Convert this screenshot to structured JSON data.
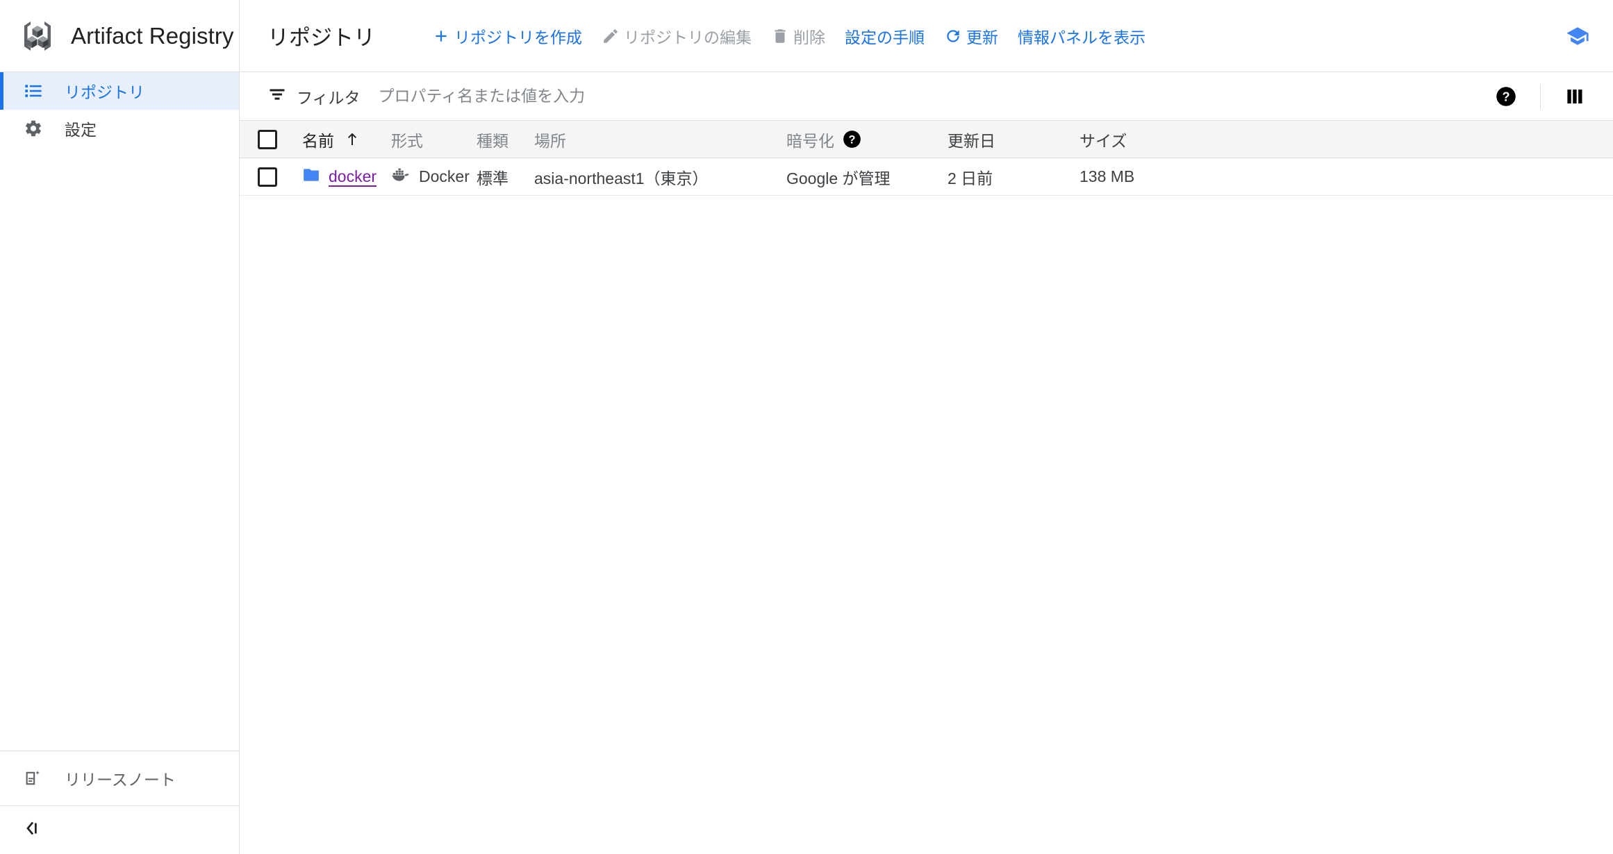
{
  "brand": {
    "title": "Artifact Registry",
    "logo_icon": "artifact-registry-cubes-logo"
  },
  "toolbar": {
    "page_title": "リポジトリ",
    "actions": [
      {
        "label": "リポジトリを作成",
        "icon": "plus-icon",
        "state": "enabled"
      },
      {
        "label": "リポジトリの編集",
        "icon": "pencil-icon",
        "state": "disabled"
      },
      {
        "label": "削除",
        "icon": "trash-icon",
        "state": "disabled"
      },
      {
        "label": "設定の手順",
        "icon": "none",
        "state": "enabled"
      },
      {
        "label": "更新",
        "icon": "refresh-icon",
        "state": "enabled"
      },
      {
        "label": "情報パネルを表示",
        "icon": "none",
        "state": "enabled"
      }
    ],
    "education_icon": "graduation-cap-icon",
    "accent_color": "#1a73e8",
    "disabled_color": "#9aa0a6"
  },
  "sidebar": {
    "items": [
      {
        "label": "リポジトリ",
        "icon": "list-icon",
        "active": true
      },
      {
        "label": "設定",
        "icon": "gear-icon",
        "active": false
      }
    ],
    "release_notes": {
      "label": "リリースノート",
      "icon": "release-notes-icon"
    },
    "collapse": {
      "icon": "collapse-panel-icon"
    },
    "active_bg": "#e8f0fe",
    "active_color": "#1a73e8"
  },
  "filter": {
    "label": "フィルタ",
    "icon": "filter-icon",
    "placeholder": "プロパティ名または値を入力",
    "value": "",
    "help_icon": "help-filled-icon",
    "columns_icon": "column-display-icon"
  },
  "table": {
    "select_all_checked": false,
    "columns": [
      {
        "key": "name",
        "label": "名前",
        "sorted": true,
        "sort_dir": "asc"
      },
      {
        "key": "format",
        "label": "形式",
        "sorted": false
      },
      {
        "key": "kind",
        "label": "種類",
        "sorted": false
      },
      {
        "key": "location",
        "label": "場所",
        "sorted": false
      },
      {
        "key": "encryption",
        "label": "暗号化",
        "sorted": false,
        "help_icon": "help-filled-icon"
      },
      {
        "key": "updated",
        "label": "更新日",
        "sorted": false
      },
      {
        "key": "size",
        "label": "サイズ",
        "sorted": false
      }
    ],
    "rows": [
      {
        "checked": false,
        "name": "docker",
        "name_icon": "folder-icon",
        "format": "Docker",
        "format_icon": "docker-whale-icon",
        "kind": "標準",
        "location": "asia-northeast1（東京）",
        "encryption": "Google が管理",
        "updated": "2 日前",
        "size": "138 MB"
      }
    ]
  }
}
